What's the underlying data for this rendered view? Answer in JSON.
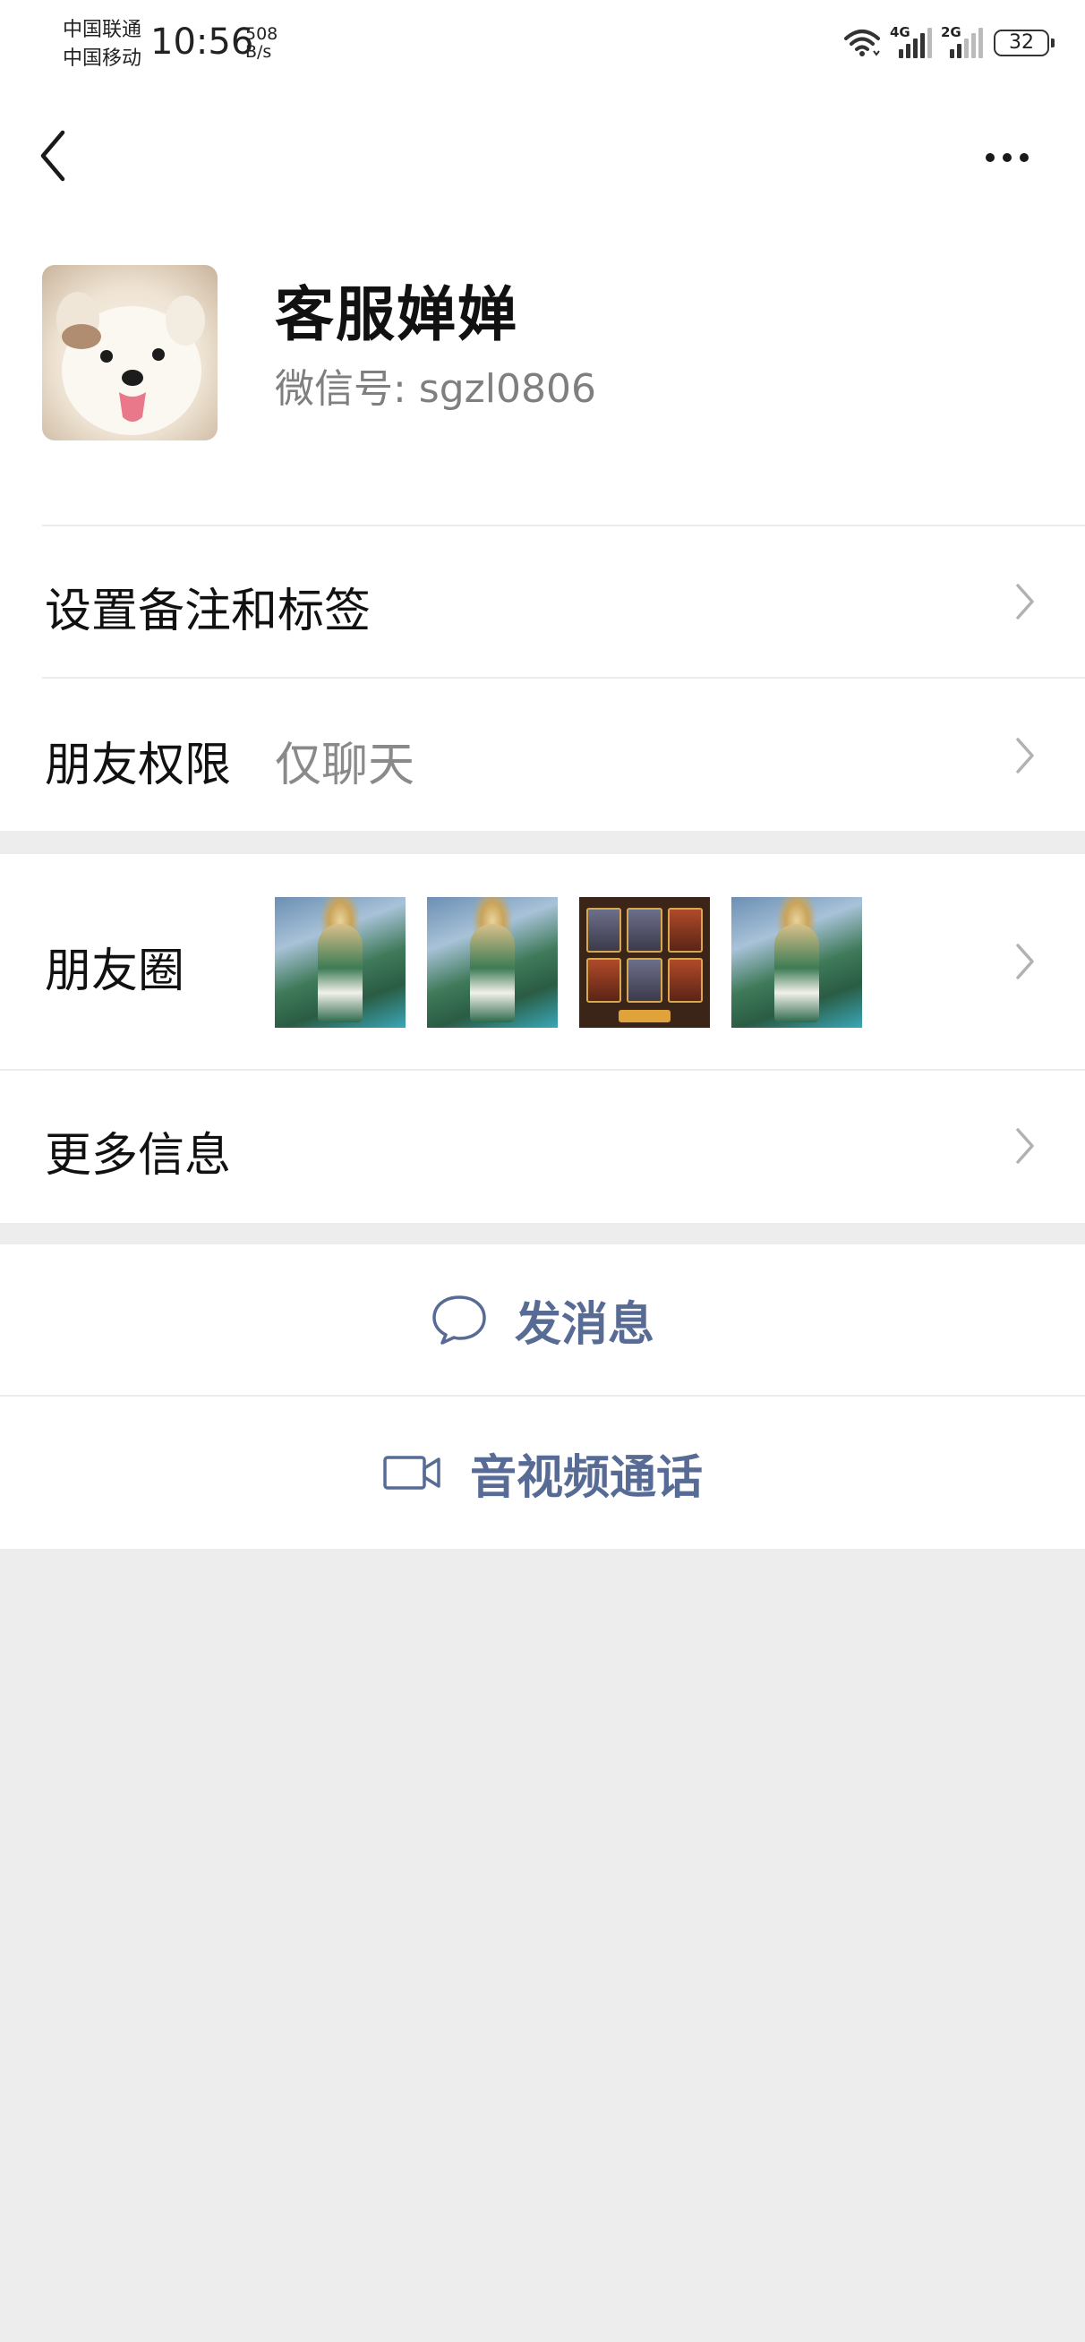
{
  "status_bar": {
    "carrier_1": "中国联通",
    "carrier_2": "中国移动",
    "time": "10:56",
    "speed_value": "508",
    "speed_unit": "B/s",
    "network_1": "4G",
    "network_2": "2G",
    "battery": "32"
  },
  "profile": {
    "name": "客服婵婵",
    "wechat_id": "微信号: sgzl0806"
  },
  "rows": {
    "remark": {
      "label": "设置备注和标签"
    },
    "permission": {
      "label": "朋友权限",
      "value": "仅聊天"
    },
    "moments": {
      "label": "朋友圈"
    },
    "more_info": {
      "label": "更多信息"
    }
  },
  "actions": {
    "message": "发消息",
    "call": "音视频通话"
  },
  "colors": {
    "link": "#576b95",
    "background": "#ededed"
  },
  "icons": [
    "back-arrow-icon",
    "more-dots-icon",
    "chevron-right-icon",
    "chat-bubble-icon",
    "video-camera-icon",
    "wifi-icon",
    "signal-icon",
    "battery-icon"
  ]
}
